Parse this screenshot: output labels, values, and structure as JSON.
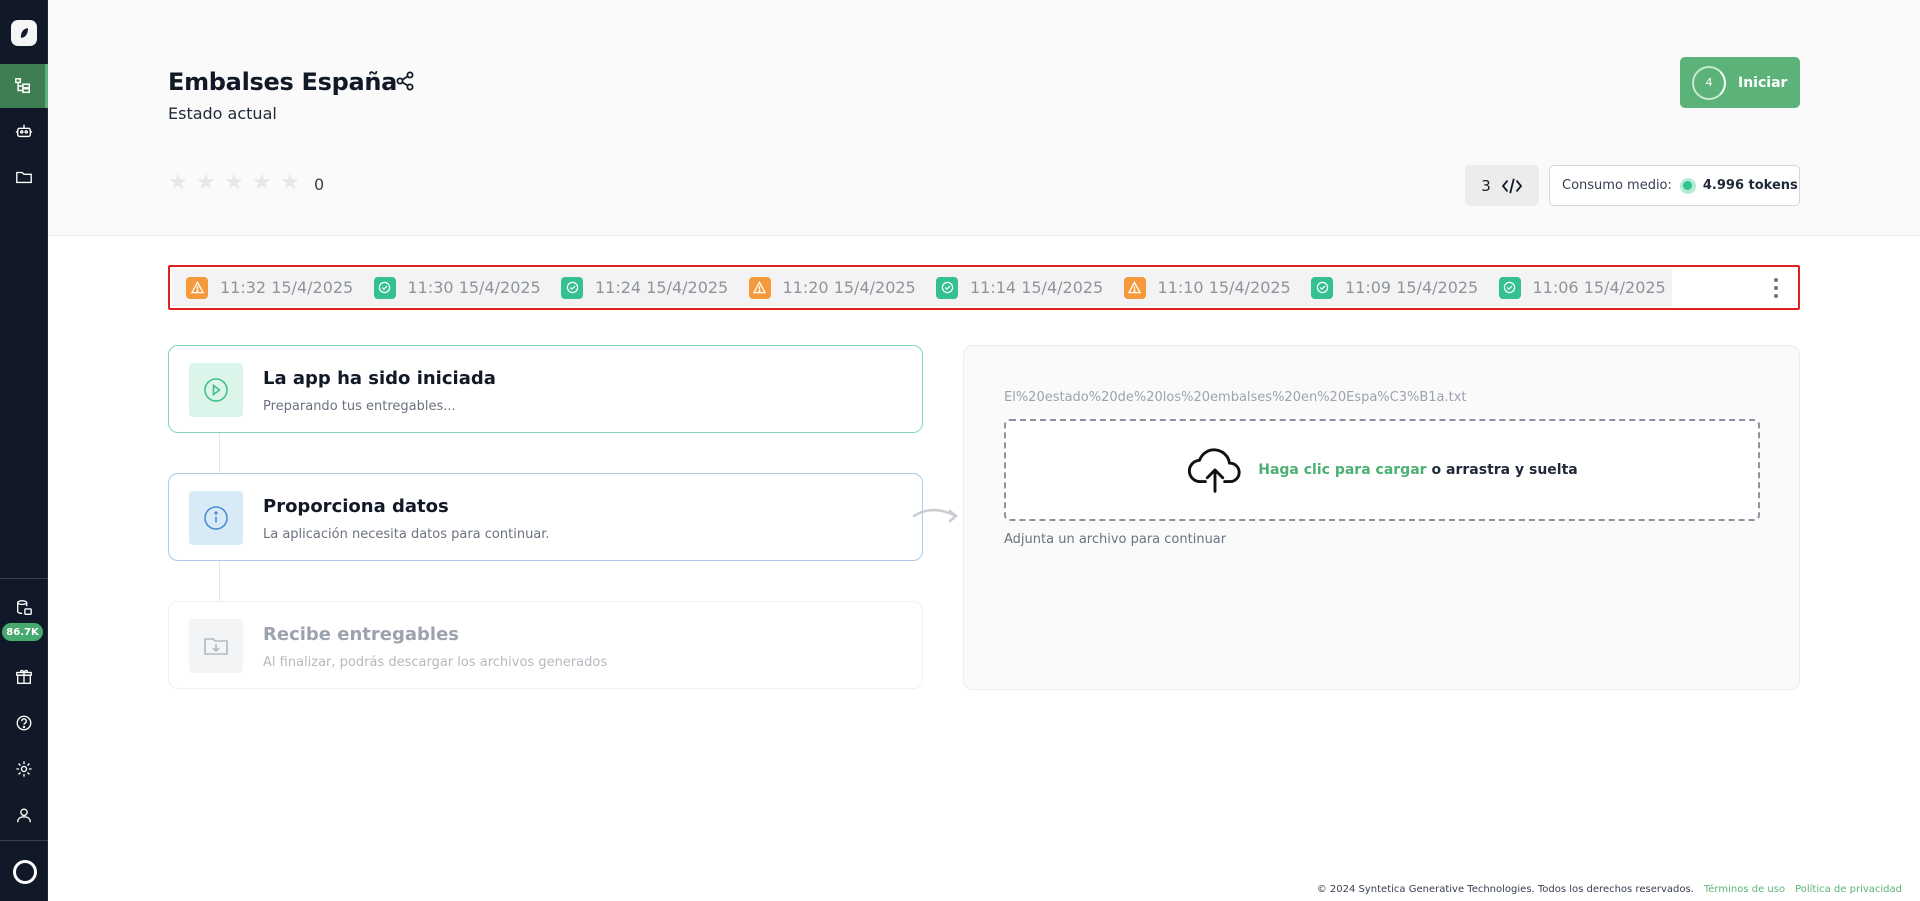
{
  "sidebar": {
    "badge": "86.7K",
    "items": [
      "workflow-icon",
      "robot-icon",
      "folder-icon",
      "database-icon",
      "gift-icon",
      "help-icon",
      "settings-icon",
      "user-icon"
    ]
  },
  "header": {
    "title": "Embalses España",
    "subtitle": "Estado actual",
    "start_label": "Iniciar",
    "start_count": "4",
    "rating_count": "0",
    "rating_stars": 0,
    "code_count": "3",
    "consumo_label": "Consumo medio:",
    "consumo_value": "4.996 tokens"
  },
  "history": [
    {
      "status": "warning",
      "label": "11:32 15/4/2025"
    },
    {
      "status": "success",
      "label": "11:30 15/4/2025"
    },
    {
      "status": "success",
      "label": "11:24 15/4/2025"
    },
    {
      "status": "warning",
      "label": "11:20 15/4/2025"
    },
    {
      "status": "success",
      "label": "11:14 15/4/2025"
    },
    {
      "status": "warning",
      "label": "11:10 15/4/2025"
    },
    {
      "status": "success",
      "label": "11:09 15/4/2025"
    },
    {
      "status": "success",
      "label": "11:06 15/4/2025"
    }
  ],
  "steps": [
    {
      "title": "La app ha sido iniciada",
      "subtitle": "Preparando tus entregables..."
    },
    {
      "title": "Proporciona datos",
      "subtitle": "La aplicación necesita datos para continuar."
    },
    {
      "title": "Recibe entregables",
      "subtitle": "Al finalizar, podrás descargar los archivos generados"
    }
  ],
  "upload": {
    "filename": "El%20estado%20de%20los%20embalses%20en%20Espa%C3%B1a.txt",
    "link_text": "Haga clic para cargar",
    "rest_text": "o arrastra y suelta",
    "hint": "Adjunta un archivo para continuar"
  },
  "footer": {
    "copyright": "© 2024 Syntetica Generative Technologies. Todos los derechos reservados.",
    "terms": "Términos de uso",
    "privacy": "Política de privacidad"
  },
  "colors": {
    "accent": "#5bb37a",
    "sidebar": "#111827",
    "warning": "#f59a3c",
    "success": "#35c08f"
  }
}
